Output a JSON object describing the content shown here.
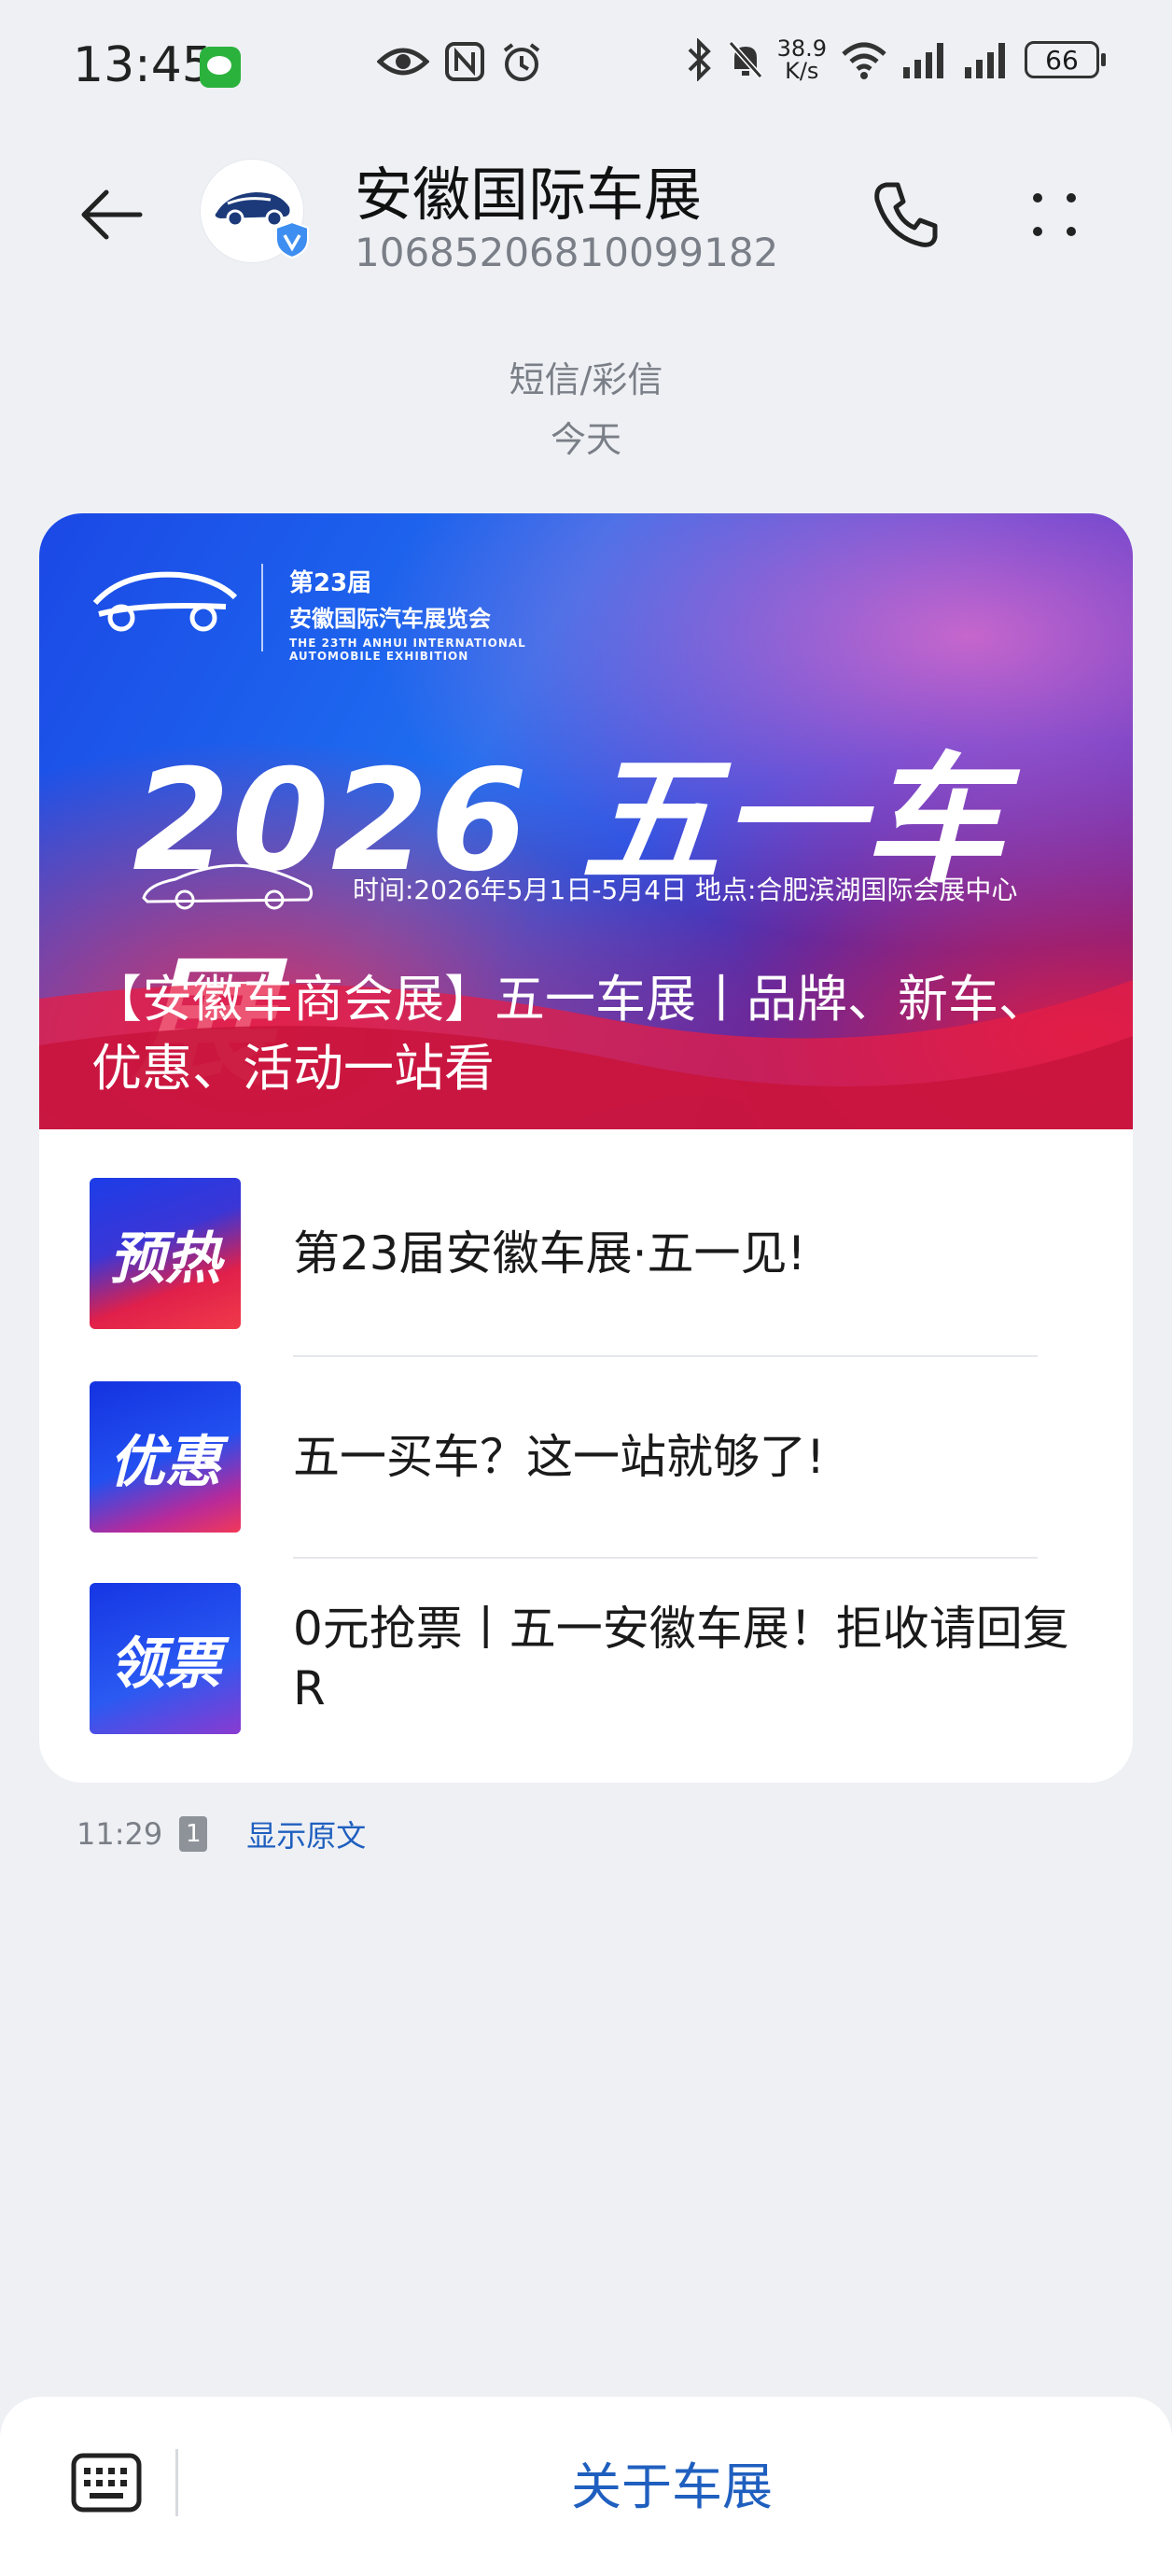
{
  "status_bar": {
    "time": "13:45",
    "speed_value": "38.9",
    "speed_unit": "K/s",
    "battery": "66",
    "icons": [
      "wechat-icon",
      "eye-icon",
      "nfc-icon",
      "alarm-icon",
      "bluetooth-icon",
      "mute-icon",
      "wifi-icon",
      "signal-icon",
      "signal-icon",
      "battery-icon"
    ]
  },
  "header": {
    "title": "安徽国际车展",
    "number": "10685206810099182"
  },
  "thread_meta": {
    "type": "短信/彩信",
    "date": "今天"
  },
  "card": {
    "banner": {
      "logo_line1": "第23届",
      "logo_line2": "安徽国际汽车展览会",
      "logo_line3": "THE 23TH ANHUI INTERNATIONAL",
      "logo_line4": "AUTOMOBILE EXHIBITION",
      "headline": "2026 五一车展",
      "time_place": "时间:2026年5月1日-5月4日    地点:合肥滨湖国际会展中心",
      "caption": "【安徽车商会展】五一车展丨品牌、新车、优惠、活动一站看"
    },
    "items": [
      {
        "thumb": "预热",
        "label": "第23届安徽车展·五一见!"
      },
      {
        "thumb": "优惠",
        "label": "五一买车？这一站就够了!"
      },
      {
        "thumb": "领票",
        "label": "0元抢票丨五一安徽车展！拒收请回复R"
      }
    ]
  },
  "message_footer": {
    "time": "11:29",
    "sim": "1",
    "show_original": "显示原文"
  },
  "bottom_bar": {
    "menu_label": "关于车展"
  },
  "colors": {
    "accent": "#1f5fbf",
    "background": "#eef0f4"
  }
}
